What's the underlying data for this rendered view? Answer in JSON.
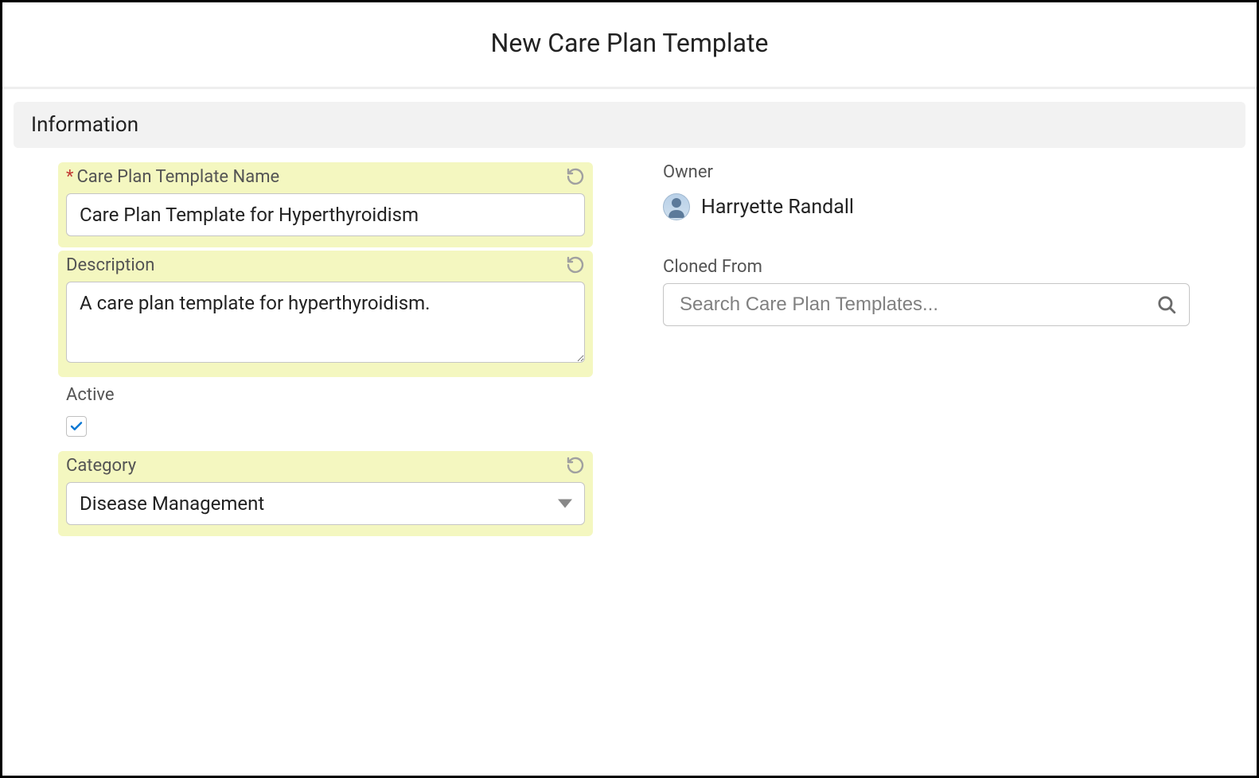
{
  "modal_title": "New Care Plan Template",
  "section_title": "Information",
  "fields": {
    "name": {
      "label": "Care Plan Template Name",
      "value": "Care Plan Template for Hyperthyroidism",
      "required_marker": "*"
    },
    "description": {
      "label": "Description",
      "value": "A care plan template for hyperthyroidism."
    },
    "active": {
      "label": "Active",
      "checked": true
    },
    "category": {
      "label": "Category",
      "value": "Disease Management"
    },
    "owner": {
      "label": "Owner",
      "name": "Harryette Randall"
    },
    "cloned_from": {
      "label": "Cloned From",
      "placeholder": "Search Care Plan Templates..."
    }
  }
}
